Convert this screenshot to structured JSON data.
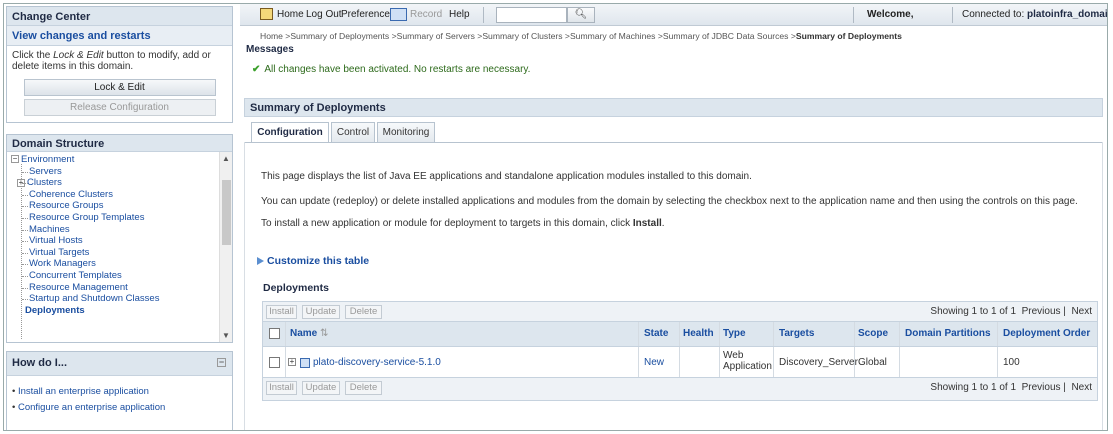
{
  "change_center": {
    "title": "Change Center",
    "view_link": "View changes and restarts",
    "desc_pre": "Click the ",
    "desc_em": "Lock & Edit",
    "desc_post": " button to modify, add or delete items in this domain.",
    "lock_edit": "Lock & Edit",
    "release": "Release Configuration"
  },
  "domain_structure": {
    "title": "Domain Structure",
    "root": "Environment",
    "items": [
      "Servers",
      "Clusters",
      "Coherence Clusters",
      "Resource Groups",
      "Resource Group Templates",
      "Machines",
      "Virtual Hosts",
      "Virtual Targets",
      "Work Managers",
      "Concurrent Templates",
      "Resource Management",
      "Startup and Shutdown Classes"
    ],
    "selected": "Deployments"
  },
  "how_do_i": {
    "title": "How do I...",
    "items": [
      "Install an enterprise application",
      "Configure an enterprise application"
    ]
  },
  "topbar": {
    "home": "Home",
    "logout": "Log Out",
    "preferences": "Preferences",
    "record": "Record",
    "help": "Help",
    "search_value": "",
    "welcome": "Welcome,",
    "connected_label": "Connected to: ",
    "connected_value": "platoinfra_domain"
  },
  "breadcrumb": {
    "trail": "Home >Summary of Deployments >Summary of Servers >Summary of Clusters >Summary of Machines >Summary of JDBC Data Sources >",
    "current": "Summary of Deployments"
  },
  "messages": {
    "title": "Messages",
    "text": "All changes have been activated. No restarts are necessary."
  },
  "summary": {
    "title": "Summary of Deployments",
    "tabs": [
      "Configuration",
      "Control",
      "Monitoring"
    ],
    "p1": "This page displays the list of Java EE applications and standalone application modules installed to this domain.",
    "p2": "You can update (redeploy) or delete installed applications and modules from the domain by selecting the checkbox next to the application name and then using the controls on this page.",
    "p3_pre": "To install a new application or module for deployment to targets in this domain, click ",
    "p3_bold": "Install",
    "p3_post": ".",
    "customize": "Customize this table"
  },
  "deployments": {
    "title": "Deployments",
    "buttons": {
      "install": "Install",
      "update": "Update",
      "delete": "Delete"
    },
    "showing": "Showing 1 to 1 of 1",
    "previous": "Previous",
    "next": "Next",
    "columns": {
      "name": "Name",
      "state": "State",
      "health": "Health",
      "type": "Type",
      "targets": "Targets",
      "scope": "Scope",
      "partitions": "Domain Partitions",
      "order": "Deployment Order"
    },
    "row": {
      "name": "plato-discovery-service-5.1.0",
      "state": "New",
      "health": "",
      "type_l1": "Web",
      "type_l2": "Application",
      "targets": "Discovery_Server",
      "scope": "Global",
      "partitions": "",
      "order": "100"
    }
  }
}
